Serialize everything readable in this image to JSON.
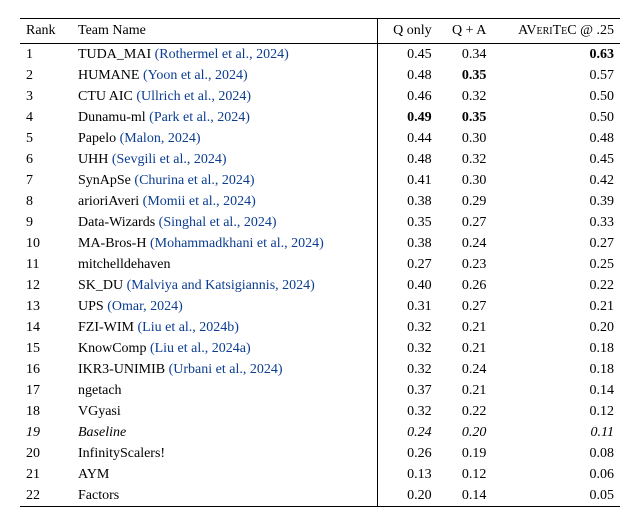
{
  "chart_data": {
    "type": "table",
    "title": "",
    "columns": [
      "Rank",
      "Team Name",
      "Q only",
      "Q + A",
      "AVeriTeC @ .25"
    ],
    "rows": [
      {
        "rank": "1",
        "team": "TUDA_MAI",
        "cite": "(Rothermel et al., 2024)",
        "q": "0.45",
        "qa": "0.34",
        "av": "0.63",
        "q_bold": false,
        "qa_bold": false,
        "av_bold": true,
        "italic": false
      },
      {
        "rank": "2",
        "team": "HUMANE",
        "cite": "(Yoon et al., 2024)",
        "q": "0.48",
        "qa": "0.35",
        "av": "0.57",
        "q_bold": false,
        "qa_bold": true,
        "av_bold": false,
        "italic": false
      },
      {
        "rank": "3",
        "team": "CTU AIC",
        "cite": "(Ullrich et al., 2024)",
        "q": "0.46",
        "qa": "0.32",
        "av": "0.50",
        "q_bold": false,
        "qa_bold": false,
        "av_bold": false,
        "italic": false
      },
      {
        "rank": "4",
        "team": "Dunamu-ml",
        "cite": "(Park et al., 2024)",
        "q": "0.49",
        "qa": "0.35",
        "av": "0.50",
        "q_bold": true,
        "qa_bold": true,
        "av_bold": false,
        "italic": false
      },
      {
        "rank": "5",
        "team": "Papelo",
        "cite": "(Malon, 2024)",
        "q": "0.44",
        "qa": "0.30",
        "av": "0.48",
        "q_bold": false,
        "qa_bold": false,
        "av_bold": false,
        "italic": false
      },
      {
        "rank": "6",
        "team": "UHH",
        "cite": "(Sevgili et al., 2024)",
        "q": "0.48",
        "qa": "0.32",
        "av": "0.45",
        "q_bold": false,
        "qa_bold": false,
        "av_bold": false,
        "italic": false
      },
      {
        "rank": "7",
        "team": "SynApSe",
        "cite": "(Churina et al., 2024)",
        "q": "0.41",
        "qa": "0.30",
        "av": "0.42",
        "q_bold": false,
        "qa_bold": false,
        "av_bold": false,
        "italic": false
      },
      {
        "rank": "8",
        "team": "arioriAveri",
        "cite": "(Momii et al., 2024)",
        "q": "0.38",
        "qa": "0.29",
        "av": "0.39",
        "q_bold": false,
        "qa_bold": false,
        "av_bold": false,
        "italic": false
      },
      {
        "rank": "9",
        "team": "Data-Wizards",
        "cite": "(Singhal et al., 2024)",
        "q": "0.35",
        "qa": "0.27",
        "av": "0.33",
        "q_bold": false,
        "qa_bold": false,
        "av_bold": false,
        "italic": false
      },
      {
        "rank": "10",
        "team": "MA-Bros-H",
        "cite": "(Mohammadkhani et al., 2024)",
        "q": "0.38",
        "qa": "0.24",
        "av": "0.27",
        "q_bold": false,
        "qa_bold": false,
        "av_bold": false,
        "italic": false
      },
      {
        "rank": "11",
        "team": "mitchelldehaven",
        "cite": "",
        "q": "0.27",
        "qa": "0.23",
        "av": "0.25",
        "q_bold": false,
        "qa_bold": false,
        "av_bold": false,
        "italic": false
      },
      {
        "rank": "12",
        "team": "SK_DU",
        "cite": "(Malviya and Katsigiannis, 2024)",
        "q": "0.40",
        "qa": "0.26",
        "av": "0.22",
        "q_bold": false,
        "qa_bold": false,
        "av_bold": false,
        "italic": false
      },
      {
        "rank": "13",
        "team": "UPS",
        "cite": "(Omar, 2024)",
        "q": "0.31",
        "qa": "0.27",
        "av": "0.21",
        "q_bold": false,
        "qa_bold": false,
        "av_bold": false,
        "italic": false
      },
      {
        "rank": "14",
        "team": "FZI-WIM",
        "cite": "(Liu et al., 2024b)",
        "q": "0.32",
        "qa": "0.21",
        "av": "0.20",
        "q_bold": false,
        "qa_bold": false,
        "av_bold": false,
        "italic": false
      },
      {
        "rank": "15",
        "team": "KnowComp",
        "cite": "(Liu et al., 2024a)",
        "q": "0.32",
        "qa": "0.21",
        "av": "0.18",
        "q_bold": false,
        "qa_bold": false,
        "av_bold": false,
        "italic": false
      },
      {
        "rank": "16",
        "team": "IKR3-UNIMIB",
        "cite": "(Urbani et al., 2024)",
        "q": "0.32",
        "qa": "0.24",
        "av": "0.18",
        "q_bold": false,
        "qa_bold": false,
        "av_bold": false,
        "italic": false
      },
      {
        "rank": "17",
        "team": "ngetach",
        "cite": "",
        "q": "0.37",
        "qa": "0.21",
        "av": "0.14",
        "q_bold": false,
        "qa_bold": false,
        "av_bold": false,
        "italic": false
      },
      {
        "rank": "18",
        "team": "VGyasi",
        "cite": "",
        "q": "0.32",
        "qa": "0.22",
        "av": "0.12",
        "q_bold": false,
        "qa_bold": false,
        "av_bold": false,
        "italic": false
      },
      {
        "rank": "19",
        "team": "Baseline",
        "cite": "",
        "q": "0.24",
        "qa": "0.20",
        "av": "0.11",
        "q_bold": false,
        "qa_bold": false,
        "av_bold": false,
        "italic": true
      },
      {
        "rank": "20",
        "team": "InfinityScalers!",
        "cite": "",
        "q": "0.26",
        "qa": "0.19",
        "av": "0.08",
        "q_bold": false,
        "qa_bold": false,
        "av_bold": false,
        "italic": false
      },
      {
        "rank": "21",
        "team": "AYM",
        "cite": "",
        "q": "0.13",
        "qa": "0.12",
        "av": "0.06",
        "q_bold": false,
        "qa_bold": false,
        "av_bold": false,
        "italic": false
      },
      {
        "rank": "22",
        "team": "Factors",
        "cite": "",
        "q": "0.20",
        "qa": "0.14",
        "av": "0.05",
        "q_bold": false,
        "qa_bold": false,
        "av_bold": false,
        "italic": false
      }
    ]
  },
  "headers": {
    "rank": "Rank",
    "team": "Team Name",
    "q": "Q only",
    "qa": "Q + A",
    "av_sc": "AVeriTeC",
    "av_tail": " @ .25"
  }
}
